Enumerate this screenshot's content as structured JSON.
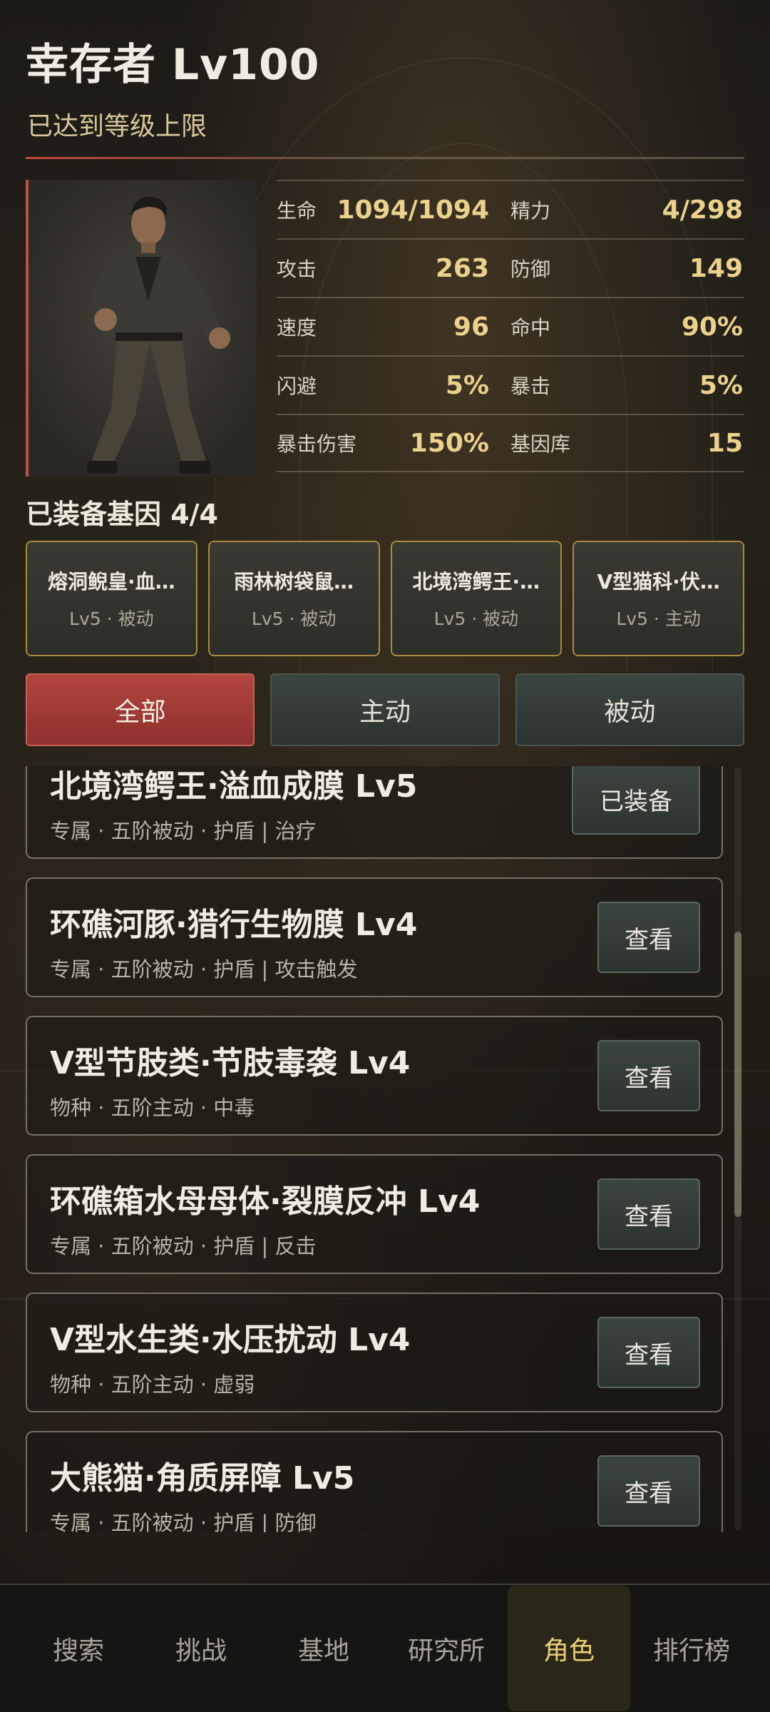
{
  "header": {
    "title": "幸存者 Lv100",
    "subtitle": "已达到等级上限"
  },
  "stats": [
    [
      {
        "label": "生命",
        "value": "1094/1094"
      },
      {
        "label": "精力",
        "value": "4/298"
      }
    ],
    [
      {
        "label": "攻击",
        "value": "263"
      },
      {
        "label": "防御",
        "value": "149"
      }
    ],
    [
      {
        "label": "速度",
        "value": "96"
      },
      {
        "label": "命中",
        "value": "90%"
      }
    ],
    [
      {
        "label": "闪避",
        "value": "5%"
      },
      {
        "label": "暴击",
        "value": "5%"
      }
    ],
    [
      {
        "label": "暴击伤害",
        "value": "150%"
      },
      {
        "label": "基因库",
        "value": "15"
      }
    ]
  ],
  "equipped": {
    "title": "已装备基因 4/4",
    "slots": [
      {
        "name": "熔洞鲵皇·血…",
        "meta": "Lv5 · 被动"
      },
      {
        "name": "雨林树袋鼠…",
        "meta": "Lv5 · 被动"
      },
      {
        "name": "北境湾鳄王·…",
        "meta": "Lv5 · 被动"
      },
      {
        "name": "V型猫科·伏…",
        "meta": "Lv5 · 主动"
      }
    ]
  },
  "filters": [
    "全部",
    "主动",
    "被动"
  ],
  "active_filter": "全部",
  "genes": [
    {
      "name": "北境湾鳄王·溢血成膜 Lv5",
      "tags": "专属 · 五阶被动 · 护盾 | 治疗",
      "button": "已装备"
    },
    {
      "name": "环礁河豚·猎行生物膜 Lv4",
      "tags": "专属 · 五阶被动 · 护盾 | 攻击触发",
      "button": "查看"
    },
    {
      "name": "V型节肢类·节肢毒袭 Lv4",
      "tags": "物种 · 五阶主动 · 中毒",
      "button": "查看"
    },
    {
      "name": "环礁箱水母母体·裂膜反冲 Lv4",
      "tags": "专属 · 五阶被动 · 护盾 | 反击",
      "button": "查看"
    },
    {
      "name": "V型水生类·水压扰动 Lv4",
      "tags": "物种 · 五阶主动 · 虚弱",
      "button": "查看"
    },
    {
      "name": "大熊猫·角质屏障 Lv5",
      "tags": "专属 · 五阶被动 · 护盾 | 防御",
      "button": "查看"
    }
  ],
  "nav": [
    "搜索",
    "挑战",
    "基地",
    "研究所",
    "角色",
    "排行榜"
  ],
  "active_nav": "角色",
  "colors": {
    "accent_red": "#b3453f",
    "gold": "#ead18d",
    "slot_border": "#a98a3e"
  },
  "icons": {
    "portrait": "survivor-portrait"
  }
}
